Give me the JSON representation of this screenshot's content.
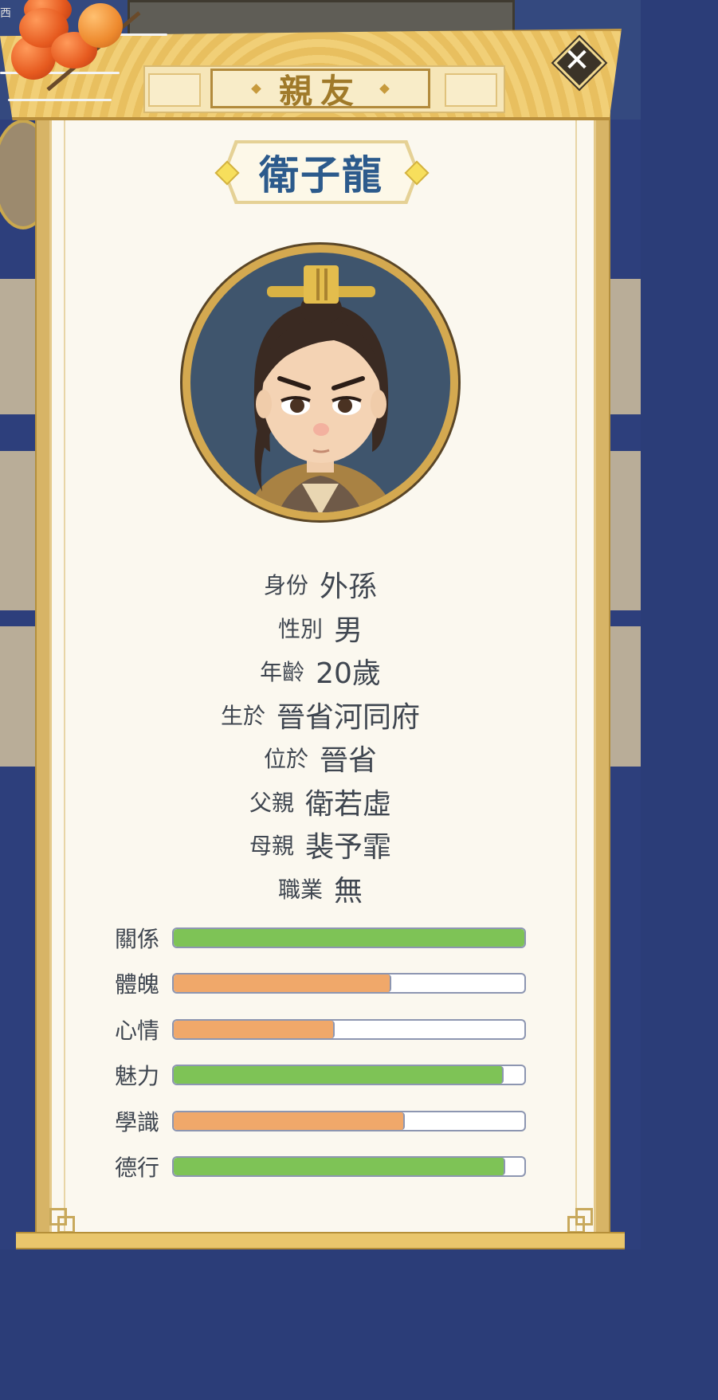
{
  "header": {
    "title": "親友"
  },
  "background": {
    "corner_text": "西",
    "title_partial": "親友"
  },
  "close_button": {
    "label": "✕"
  },
  "character": {
    "name": "衛子龍"
  },
  "info": [
    {
      "label": "身份",
      "value": "外孫"
    },
    {
      "label": "性別",
      "value": "男"
    },
    {
      "label": "年齡",
      "value": "20歲"
    },
    {
      "label": "生於",
      "value": "晉省河同府"
    },
    {
      "label": "位於",
      "value": "晉省"
    },
    {
      "label": "父親",
      "value": "衛若虛"
    },
    {
      "label": "母親",
      "value": "裴予霏"
    },
    {
      "label": "職業",
      "value": "無"
    }
  ],
  "stats": [
    {
      "label": "關係",
      "value": 1.0,
      "color": "#7ec356"
    },
    {
      "label": "體魄",
      "value": 0.62,
      "color": "#f0a86a"
    },
    {
      "label": "心情",
      "value": 0.46,
      "color": "#f0a86a"
    },
    {
      "label": "魅力",
      "value": 0.94,
      "color": "#7ec356"
    },
    {
      "label": "學識",
      "value": 0.66,
      "color": "#f0a86a"
    },
    {
      "label": "德行",
      "value": 0.945,
      "color": "#7ec356"
    }
  ],
  "colors": {
    "panel": "#fbf8ef",
    "gold": "#d7b466",
    "name_text": "#2c5a8c",
    "bar_green": "#7ec356",
    "bar_orange": "#f0a86a"
  }
}
